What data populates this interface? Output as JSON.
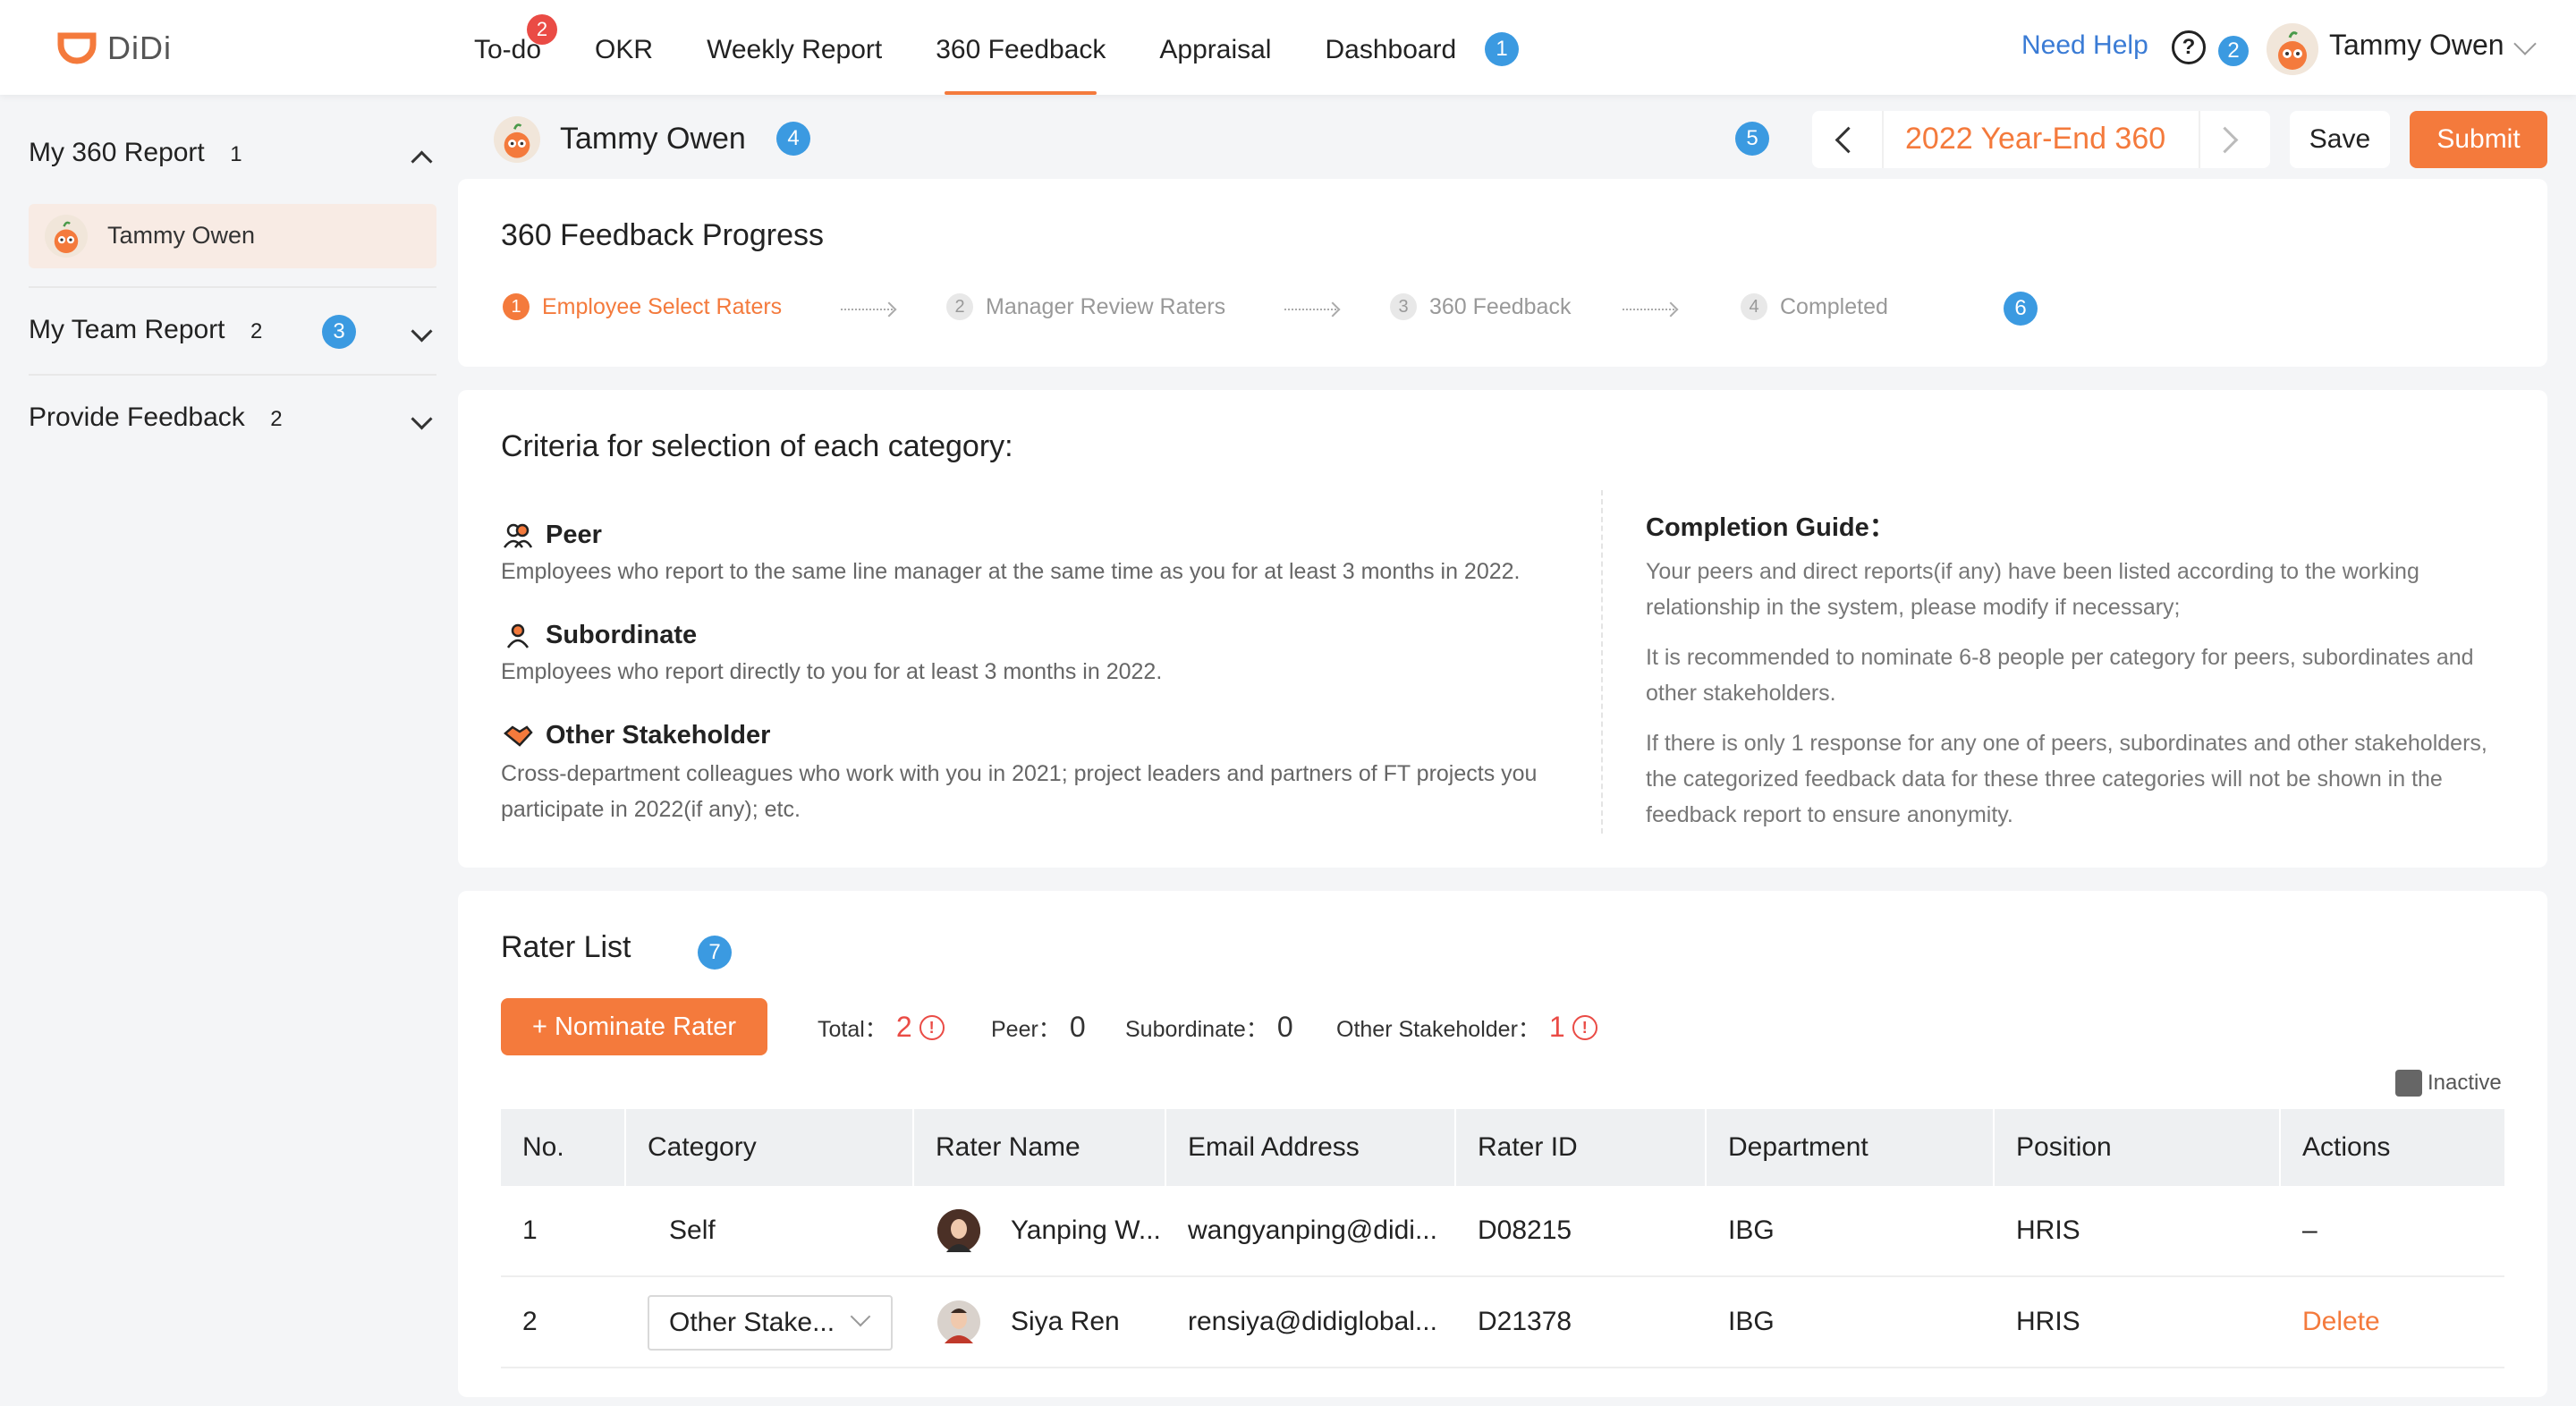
{
  "header": {
    "logo_text": "DiDi",
    "nav": [
      {
        "label": "To-do",
        "badge": "2"
      },
      {
        "label": "OKR"
      },
      {
        "label": "Weekly Report"
      },
      {
        "label": "360 Feedback",
        "active": true
      },
      {
        "label": "Appraisal"
      },
      {
        "label": "Dashboard"
      }
    ],
    "need_help": "Need Help",
    "help_glyph": "?",
    "user_name": "Tammy Owen"
  },
  "markers": [
    "1",
    "2",
    "3",
    "4",
    "5",
    "6",
    "7"
  ],
  "sidebar": {
    "my_report": {
      "label": "My 360 Report",
      "count": "1",
      "item": "Tammy Owen"
    },
    "team_report": {
      "label": "My Team Report",
      "count": "2"
    },
    "provide_feedback": {
      "label": "Provide Feedback",
      "count": "2"
    }
  },
  "content": {
    "employee_name": "Tammy Owen",
    "cycle": "2022 Year-End 360",
    "save_label": "Save",
    "submit_label": "Submit"
  },
  "progress": {
    "title": "360 Feedback Progress",
    "steps": [
      {
        "num": "1",
        "label": "Employee Select Raters",
        "active": true
      },
      {
        "num": "2",
        "label": "Manager Review Raters"
      },
      {
        "num": "3",
        "label": "360 Feedback"
      },
      {
        "num": "4",
        "label": "Completed"
      }
    ]
  },
  "criteria": {
    "title": "Criteria for selection of each category:",
    "peer": {
      "heading": "Peer",
      "text": "Employees who report to the same line manager at the same time as you for at least 3 months in 2022."
    },
    "subordinate": {
      "heading": "Subordinate",
      "text": "Employees who report directly to you for at least 3 months in 2022."
    },
    "stakeholder": {
      "heading": "Other Stakeholder",
      "text1": "Cross-department colleagues who work with you in 2021; project leaders and partners of FT projects you",
      "text2": "participate in 2022(if any); etc."
    },
    "guide_title": "Completion Guide：",
    "guide": [
      [
        "Your peers and direct reports(if any) have been listed according to the working",
        "relationship in the system, please modify if necessary;"
      ],
      [
        "It is recommended to nominate 6-8 people per category for peers, subordinates and",
        "other stakeholders."
      ],
      [
        "If there is only 1 response for any one of peers, subordinates and other stakeholders,",
        "the categorized feedback data for these three categories will not be shown in the",
        "feedback report to ensure anonymity."
      ]
    ]
  },
  "raters": {
    "title": "Rater List",
    "nominate_label": "+ Nominate Rater",
    "stats": {
      "total_label": "Total：",
      "total": "2",
      "peer_label": "Peer：",
      "peer": "0",
      "subordinate_label": "Subordinate：",
      "subordinate": "0",
      "stakeholder_label": "Other Stakeholder：",
      "stakeholder": "1"
    },
    "warn_glyph": "!",
    "inactive_label": "Inactive",
    "columns": [
      "No.",
      "Category",
      "Rater Name",
      "Email Address",
      "Rater ID",
      "Department",
      "Position",
      "Actions"
    ],
    "rows": [
      {
        "no": "1",
        "category": "Self",
        "name": "Yanping W...",
        "email": "wangyanping@didi...",
        "id": "D08215",
        "dept": "IBG",
        "position": "HRIS",
        "action": "–"
      },
      {
        "no": "2",
        "category": "Other Stake...",
        "name": "Siya Ren",
        "email": "rensiya@didiglobal...",
        "id": "D21378",
        "dept": "IBG",
        "position": "HRIS",
        "action": "Delete"
      }
    ]
  },
  "colors": {
    "accent": "#f47a3c",
    "badge_red": "#ea4b45",
    "marker_blue": "#3b9ae1",
    "link_blue": "#3a7bd5"
  }
}
